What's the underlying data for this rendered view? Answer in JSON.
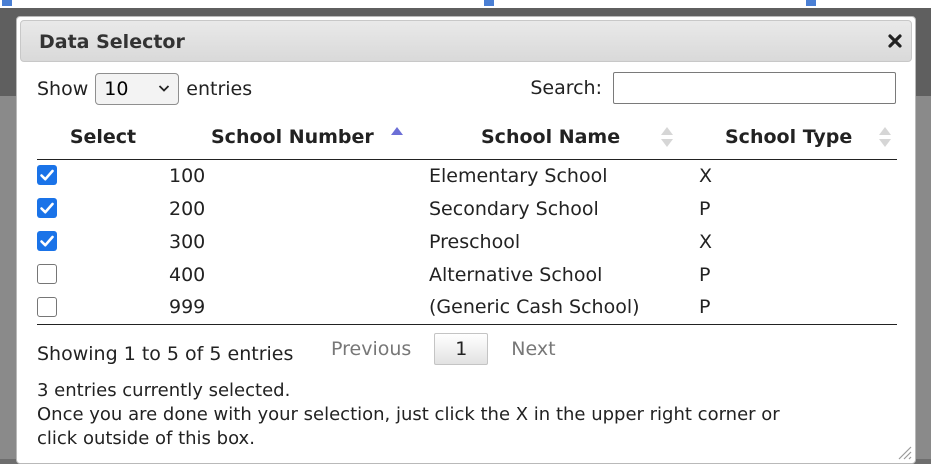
{
  "dialog": {
    "title": "Data Selector",
    "close_icon": "close-x-icon",
    "length_prefix": "Show",
    "length_value": "10",
    "length_suffix": "entries",
    "search_label": "Search:",
    "search_value": "",
    "columns": [
      "Select",
      "School Number",
      "School Name",
      "School Type"
    ],
    "sort": {
      "column": "School Number",
      "direction": "ascending"
    },
    "rows": [
      {
        "selected": true,
        "number": "100",
        "name": "Elementary School",
        "type": "X"
      },
      {
        "selected": true,
        "number": "200",
        "name": "Secondary School",
        "type": "P"
      },
      {
        "selected": true,
        "number": "300",
        "name": "Preschool",
        "type": "X"
      },
      {
        "selected": false,
        "number": "400",
        "name": "Alternative School",
        "type": "P"
      },
      {
        "selected": false,
        "number": "999",
        "name": "(Generic Cash School)",
        "type": "P"
      }
    ],
    "info": "Showing 1 to 5 of 5 entries",
    "pager": {
      "previous": "Previous",
      "page": "1",
      "next": "Next"
    },
    "selected_count_text": "3 entries currently selected.",
    "instruction_line1": "Once you are done with your selection, just click the X in the upper right corner or",
    "instruction_line2": "click outside of this box."
  },
  "colors": {
    "checkbox_checked": "#1a73e8",
    "titlebar": "#e2e2e2",
    "sort_active": "#6c6fd6",
    "sort_inactive": "#d6d6d6",
    "overlay": "#6e6e6e"
  }
}
